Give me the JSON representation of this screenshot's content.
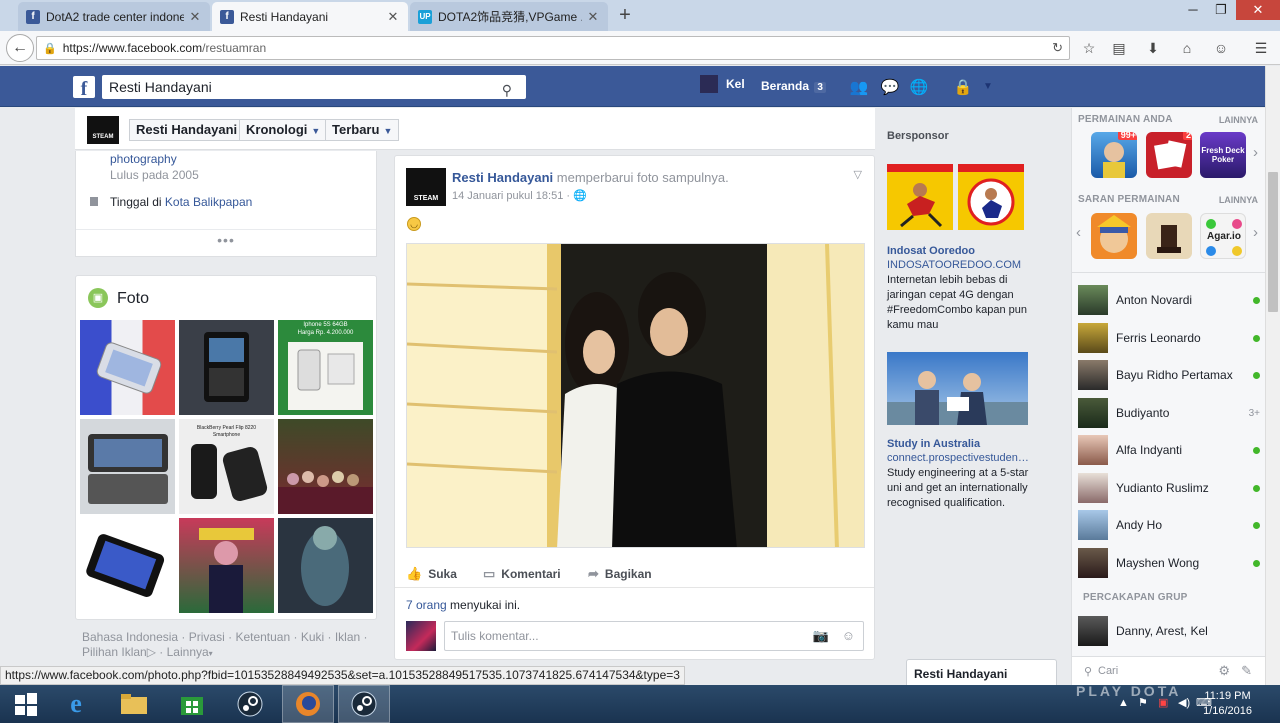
{
  "browser": {
    "tabs": [
      {
        "label": "DotA2 trade center indone...",
        "favicon": "facebook-icon",
        "active": false
      },
      {
        "label": "Resti Handayani",
        "favicon": "facebook-icon",
        "active": true
      },
      {
        "label": "DOTA2饰品竞猜,VPGame ...",
        "favicon": "vpgame-icon",
        "active": false
      }
    ],
    "url_domain": "https://www.facebook.com",
    "url_path": "/restuamran",
    "status_url": "https://www.facebook.com/photo.php?fbid=10153528849492535&set=a.10153528849517535.1073741825.674147534&type=3"
  },
  "fb_header": {
    "search_value": "Resti Handayani",
    "user_short": "Kel",
    "home_label": "Beranda",
    "home_count": "3"
  },
  "profile_nav": {
    "name_button": "Resti Handayani",
    "timeline_button": "Kronologi",
    "recent_button": "Terbaru",
    "avatar_text": "STEAM"
  },
  "intro": {
    "education_link": "photography",
    "graduated": "Lulus pada 2005",
    "lives_prefix": "Tinggal di ",
    "lives_city": "Kota Balikpapan",
    "more": "•••"
  },
  "photos": {
    "title": "Foto",
    "thumb_texts": [
      "Iphone 5S 64GB",
      "Harga Rp. 4.200.000",
      "BlackBerry Pearl Flip 8220",
      "Smartphone"
    ]
  },
  "footer": {
    "links": [
      "Bahasa Indonesia",
      "Privasi",
      "Ketentuan",
      "Kuki",
      "Iklan",
      "Pilihan Iklan",
      "Lainnya"
    ]
  },
  "post": {
    "author": "Resti Handayani",
    "action": "memperbarui foto sampulnya.",
    "date": "14 Januari pukul 18:51",
    "avatar_text": "STEAM",
    "like_label": "Suka",
    "comment_label": "Komentari",
    "share_label": "Bagikan",
    "likes_count": "7 orang",
    "likes_suffix": " menyukai ini.",
    "comment_placeholder": "Tulis komentar..."
  },
  "sponsor": {
    "heading": "Bersponsor",
    "ads": [
      {
        "title": "Indosat Ooredoo",
        "domain": "INDOSATOOREDOO.COM",
        "desc": "Internetan lebih bebas di jaringan cepat 4G dengan #FreedomCombo kapan pun kamu mau"
      },
      {
        "title": "Study in Australia",
        "domain": "connect.prospectivestudent....",
        "desc": "Study engineering at a 5-star uni and get an internationally recognised qualification."
      }
    ]
  },
  "right_sidebar": {
    "games_heading": "PERMAINAN ANDA",
    "games_more": "LAINNYA",
    "game_badges": [
      "99+",
      "2"
    ],
    "game_labels": [
      "Fresh Deck Poker",
      "Agar.io"
    ],
    "suggest_heading": "SARAN PERMAINAN",
    "suggest_more": "LAINNYA",
    "friends": [
      {
        "name": "Anton Novardi",
        "status": "online"
      },
      {
        "name": "Ferris Leonardo",
        "status": "online"
      },
      {
        "name": "Bayu Ridho Pertamax",
        "status": "online"
      },
      {
        "name": "Budiyanto",
        "status": "3+"
      },
      {
        "name": "Alfa Indyanti",
        "status": "online"
      },
      {
        "name": "Yudianto Ruslimz",
        "status": "online"
      },
      {
        "name": "Andy Ho",
        "status": "online"
      },
      {
        "name": "Mayshen Wong",
        "status": "online"
      }
    ],
    "group_heading": "PERCAKAPAN GRUP",
    "group_name": "Danny, Arest, Kel",
    "search_placeholder": "Cari"
  },
  "chat_tab": {
    "name": "Resti Handayani"
  },
  "taskbar": {
    "time": "11:19 PM",
    "date": "1/16/2016",
    "watermark": "PLAY DOTA"
  },
  "colors": {
    "fb_blue": "#3b5998",
    "link": "#365899",
    "online": "#42b72a"
  }
}
